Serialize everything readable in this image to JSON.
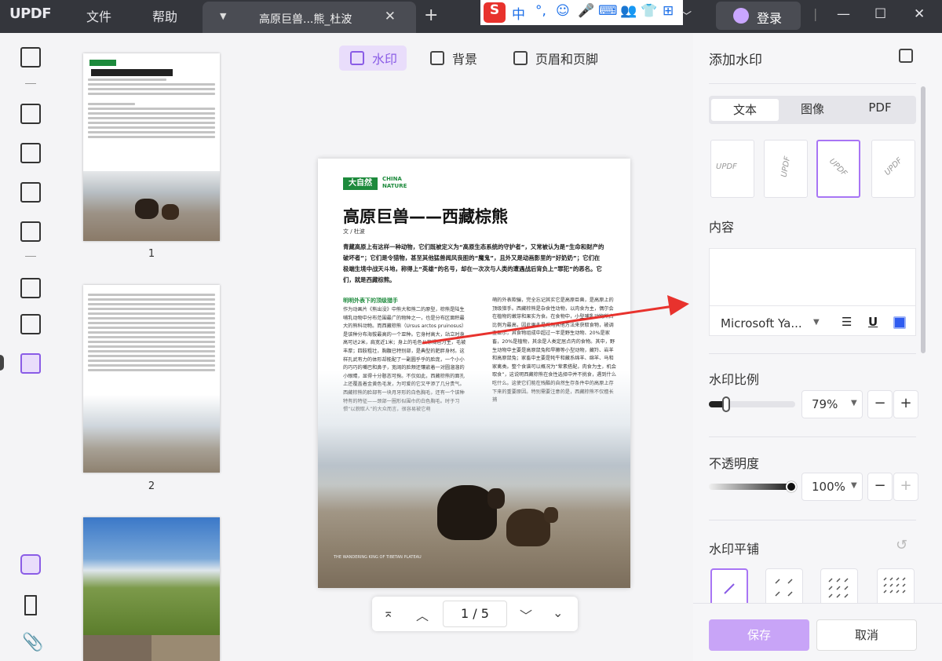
{
  "app": {
    "logo": "UPDF",
    "menu": [
      "文件",
      "帮助"
    ]
  },
  "tab": {
    "title": "高原巨兽...熊_杜波",
    "close": "✕",
    "new_tab": "+"
  },
  "ime": {
    "items": [
      "S",
      "中",
      "°,",
      "☺",
      "🎤",
      "⌨",
      "👥",
      "👕",
      "⊞"
    ]
  },
  "account": {
    "login_label": "登录"
  },
  "window": {
    "minimize": "—",
    "maximize": "☐",
    "close": "✕"
  },
  "toolbar": {
    "watermark": "水印",
    "background": "背景",
    "header_footer": "页眉和页脚"
  },
  "thumbnails": [
    {
      "page": "1"
    },
    {
      "page": "2"
    },
    {
      "page": ""
    }
  ],
  "document": {
    "brand": "大自然",
    "brand_en_1": "CHINA",
    "brand_en_2": "NATURE",
    "title": "高原巨兽——西藏棕熊",
    "author": "文 / 杜波",
    "intro": "青藏高原上有这样一种动物，它们既被定义为“高原生态系统的守护者”，又常被认为是“生命和财产的破坏者”；它们是令猎物，甚至其他猛兽闻风丧胆的“魔鬼”，且外又是动画影里的“好奶奶”；它们在极端生境中战天斗地，称得上“英雄”的名号，却在一次次与人类的遭遇战后背负上“罪犯”的恶名。它们，就是西藏棕熊。",
    "section_heading": "明明外表下的顶级猎手",
    "col1": "作为动画片《熊出没》中熊大和熊二的原型，棕熊是陆生哺乳动物中分布范围最广的物种之一，也是分布区面积最大的熊科动物。而西藏棕熊（Ursus arctos pruinosus）是该种分布海拔最高的一个亚种。它身材高大，站立时身高可达2米，肩宽近1米；身上的毛色从棕褐色为主，毛被丰厚；四肢粗壮，胸腹已特别部，是典型的肥胖身材。这样孔武有力的体形却能配了一副圆乎乎的脸庞，一个小小的巧巧的嘴巴和鼻子，宽阔的脸颊还镶嵌着一对圆溜溜的小眼睛，显得十分憨态可掬。不仅如此，西藏棕熊的面孔上还覆盖着金黄色毛发，为可爱的它又平添了几分贵气。西藏棕熊的脸部有一块月牙形的白色胸毛，还有一个该种特有的特征——颈部一圈形似围巾的白色胸毛。时于习惯“以貌取人”的大众而言，很容易被它萌",
    "col2": "萌的外表欺骗，完全忘记其实它是高原巨兽，是高原上的顶级猎手。西藏棕熊是杂食性动物，以肉食为主，偶尔会在植物的嫩芽和果实为食。在食物中，小型哺乳动物所占比例为最高，因此更多是采用其他方法来获取食物，被调查显示，其食物组成中超过一半是野生动物、20%是家畜，20%是植物，其余是人类定居点内的食物。其中，野生动物中主要是高原鼠兔和旱獭等小型动物，藏羚、岩羊和高原鼠兔；家畜中主要是牦牛和藏系绵羊、绵羊、马和家禽类。整个食谱可以概况为“荤素搭配，肉食为主，机会取食”，这说明西藏棕熊在食性选择中并不挑食，遇到什么吃什么。这使它们能在残酷的自然生存条件中的高原上存下来的重要原因。特别需要注意的是，西藏棕熊不仅擅长捕",
    "photo_caption": "THE WANDERING KING OF TIBETAN PLATEAU"
  },
  "page_nav": {
    "first": "⌅",
    "prev": "︿",
    "current": "1",
    "separator": "/",
    "total": "5",
    "next": "﹀",
    "last": "⌄"
  },
  "panel": {
    "title": "添加水印",
    "tabs": [
      "文本",
      "图像",
      "PDF"
    ],
    "style_samples": [
      "UPDF",
      "UPDF",
      "UPDF",
      "UPDF"
    ],
    "content_label": "内容",
    "font_name": "Microsoft Ya...",
    "scale_label": "水印比例",
    "scale_value": "79%",
    "scale": 0.79,
    "opacity_label": "不透明度",
    "opacity_value": "100%",
    "opacity": 1.0,
    "tile_label": "水印平铺",
    "save": "保存",
    "cancel": "取消"
  },
  "colors": {
    "accent": "#8a5ce6",
    "accent_light": "#e9ddfb",
    "save_bg": "#c8a4f7",
    "title_bar": "#34363c",
    "annotation_arrow": "#e8322d",
    "brand_green": "#1d8a3c"
  }
}
